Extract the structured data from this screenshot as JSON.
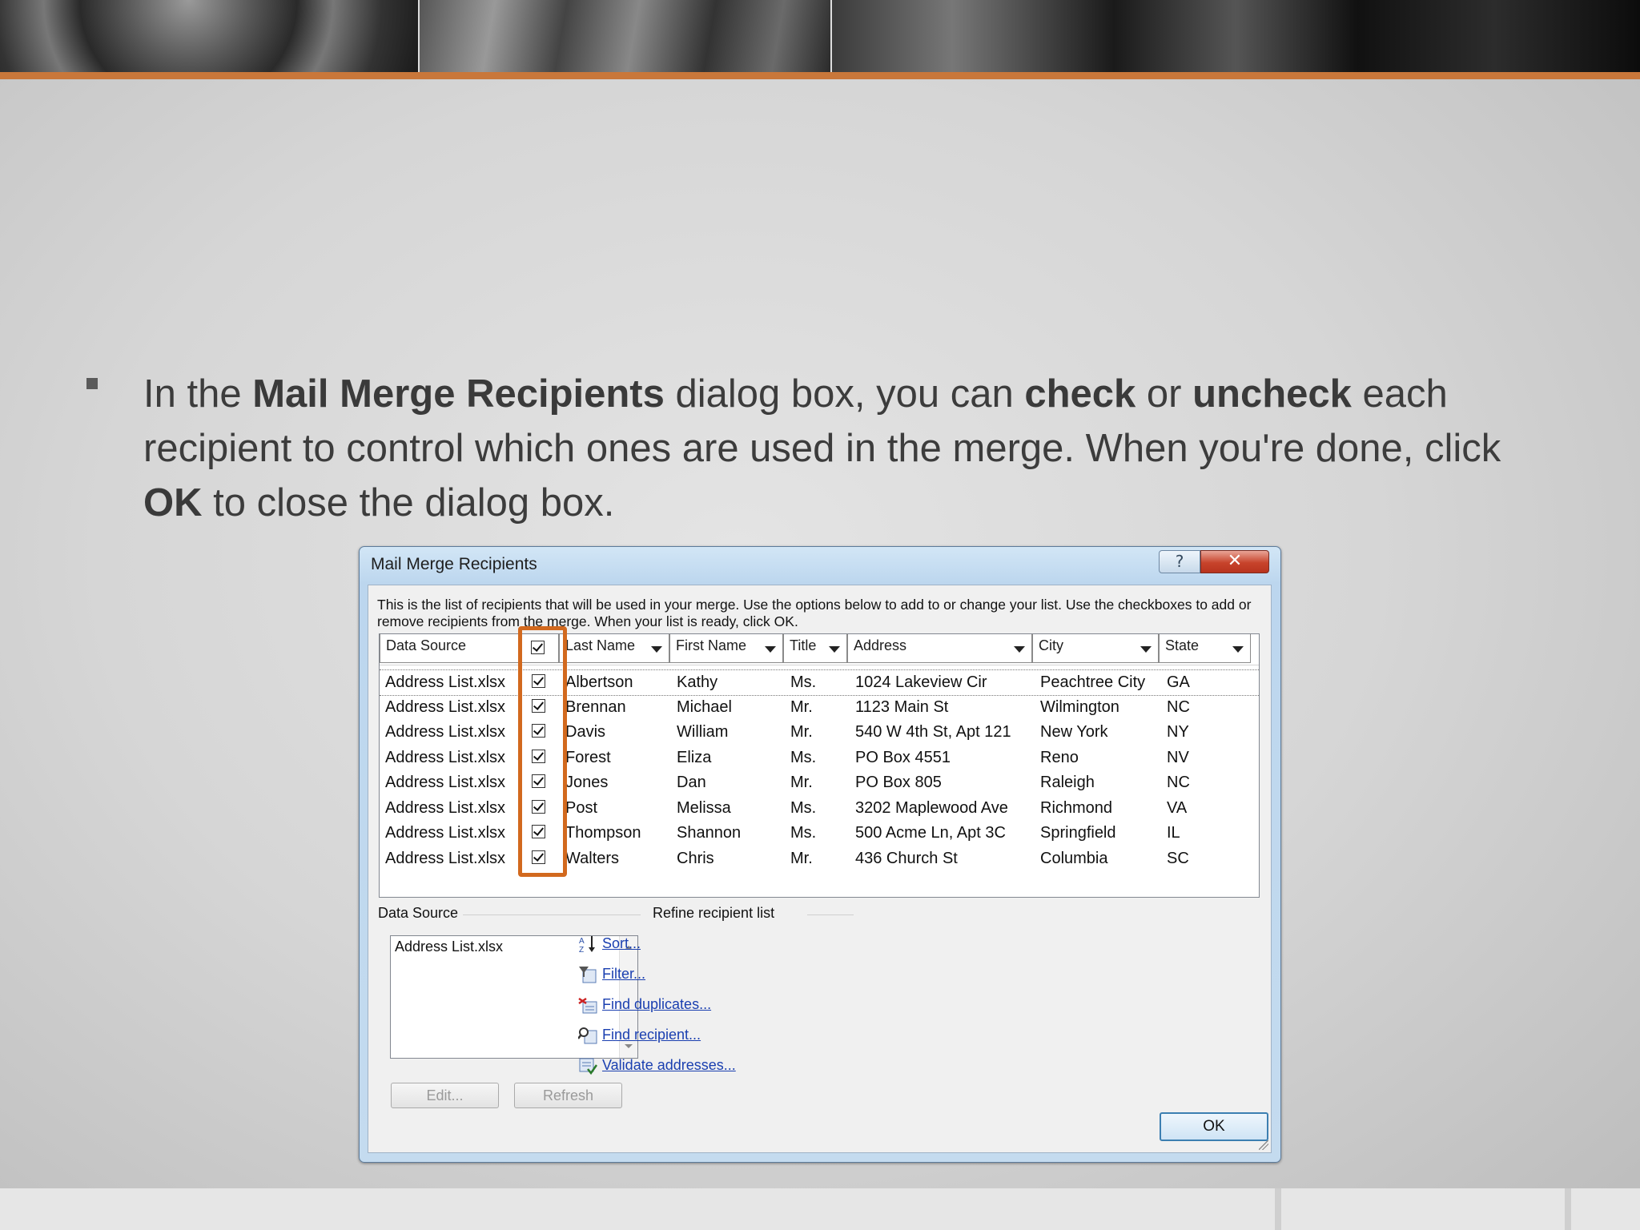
{
  "slide": {
    "bullet_runs": [
      {
        "text": "In the ",
        "bold": false
      },
      {
        "text": "Mail Merge Recipients",
        "bold": true
      },
      {
        "text": " dialog box, you can ",
        "bold": false
      },
      {
        "text": "check",
        "bold": true
      },
      {
        "text": " or ",
        "bold": false
      },
      {
        "text": "uncheck",
        "bold": true
      },
      {
        "text": " each recipient to control which ones are used in the merge. When you're done, click ",
        "bold": false
      },
      {
        "text": "OK",
        "bold": true
      },
      {
        "text": " to close the dialog box.",
        "bold": false
      }
    ],
    "accent_color": "#c9773a",
    "highlight_color": "#d2691e"
  },
  "dialog": {
    "title": "Mail Merge Recipients",
    "help_label": "?",
    "close_label": "✕",
    "description": "This is the list of recipients that will be used in your merge.  Use the options below to add to or change your list.  Use the checkboxes to add or remove recipients from the merge.  When your list is ready, click OK.",
    "columns": [
      "Data Source",
      "",
      "Last Name",
      "First Name",
      "Title",
      "Address",
      "City",
      "State"
    ],
    "rows": [
      {
        "source": "Address List.xlsx",
        "checked": true,
        "last": "Albertson",
        "first": "Kathy",
        "title": "Ms.",
        "address": "1024 Lakeview Cir",
        "city": "Peachtree City",
        "state": "GA"
      },
      {
        "source": "Address List.xlsx",
        "checked": true,
        "last": "Brennan",
        "first": "Michael",
        "title": "Mr.",
        "address": "1123 Main St",
        "city": "Wilmington",
        "state": "NC"
      },
      {
        "source": "Address List.xlsx",
        "checked": true,
        "last": "Davis",
        "first": "William",
        "title": "Mr.",
        "address": "540 W 4th St, Apt 121",
        "city": "New York",
        "state": "NY"
      },
      {
        "source": "Address List.xlsx",
        "checked": true,
        "last": "Forest",
        "first": "Eliza",
        "title": "Ms.",
        "address": "PO Box 4551",
        "city": "Reno",
        "state": "NV"
      },
      {
        "source": "Address List.xlsx",
        "checked": true,
        "last": "Jones",
        "first": "Dan",
        "title": "Mr.",
        "address": "PO Box 805",
        "city": "Raleigh",
        "state": "NC"
      },
      {
        "source": "Address List.xlsx",
        "checked": true,
        "last": "Post",
        "first": "Melissa",
        "title": "Ms.",
        "address": "3202 Maplewood Ave",
        "city": "Richmond",
        "state": "VA"
      },
      {
        "source": "Address List.xlsx",
        "checked": true,
        "last": "Thompson",
        "first": "Shannon",
        "title": "Ms.",
        "address": "500 Acme Ln, Apt 3C",
        "city": "Springfield",
        "state": "IL"
      },
      {
        "source": "Address List.xlsx",
        "checked": true,
        "last": "Walters",
        "first": "Chris",
        "title": "Mr.",
        "address": "436 Church St",
        "city": "Columbia",
        "state": "SC"
      }
    ],
    "data_source_group": {
      "label": "Data Source",
      "items": [
        "Address List.xlsx"
      ],
      "edit_label": "Edit...",
      "refresh_label": "Refresh"
    },
    "refine_group": {
      "label": "Refine recipient list",
      "links": [
        {
          "label": "Sort...",
          "icon": "sort-az-icon"
        },
        {
          "label": "Filter...",
          "icon": "filter-icon"
        },
        {
          "label": "Find duplicates...",
          "icon": "find-duplicates-icon"
        },
        {
          "label": "Find recipient...",
          "icon": "find-recipient-icon"
        },
        {
          "label": "Validate addresses...",
          "icon": "validate-addresses-icon"
        }
      ]
    },
    "ok_label": "OK"
  }
}
